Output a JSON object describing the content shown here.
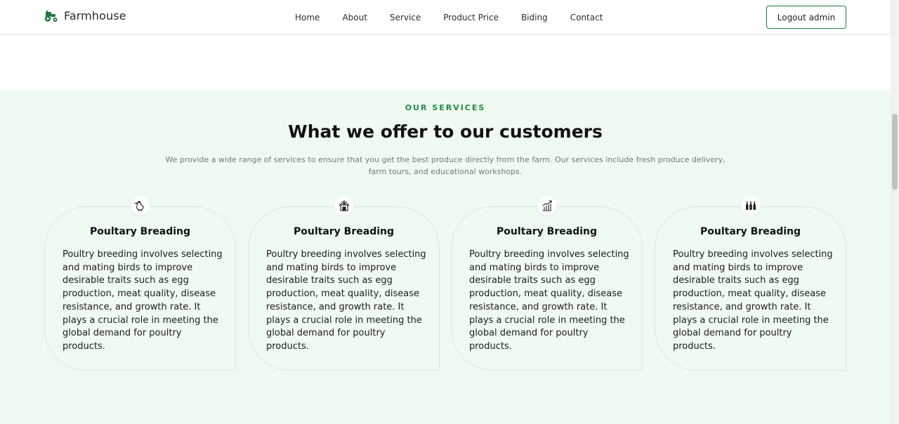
{
  "navbar": {
    "brand": "Farmhouse",
    "links": [
      "Home",
      "About",
      "Service",
      "Product Price",
      "Biding",
      "Contact"
    ],
    "logout_label": "Logout admin"
  },
  "services": {
    "eyebrow": "OUR SERVICES",
    "title": "What we offer to our customers",
    "description": "We provide a wide range of services to ensure that you get the best produce directly from the farm. Our services include fresh produce delivery, farm tours, and educational workshops.",
    "cards": [
      {
        "icon": "chicken-icon",
        "title": "Poultary Breading",
        "text": "Poultry breeding involves selecting and mating birds to improve desirable traits such as egg production, meat quality, disease resistance, and growth rate. It plays a crucial role in meeting the global demand for poultry products."
      },
      {
        "icon": "barn-icon",
        "title": "Poultary Breading",
        "text": "Poultry breeding involves selecting and mating birds to improve desirable traits such as egg production, meat quality, disease resistance, and growth rate. It plays a crucial role in meeting the global demand for poultry products."
      },
      {
        "icon": "growth-chart-icon",
        "title": "Poultary Breading",
        "text": "Poultry breeding involves selecting and mating birds to improve desirable traits such as egg production, meat quality, disease resistance, and growth rate. It plays a crucial role in meeting the global demand for poultry products."
      },
      {
        "icon": "bottles-icon",
        "title": "Poultary Breading",
        "text": "Poultry breeding involves selecting and mating birds to improve desirable traits such as egg production, meat quality, disease resistance, and growth rate. It plays a crucial role in meeting the global demand for poultry products."
      }
    ]
  },
  "colors": {
    "accent": "#1e8a45",
    "section_bg": "#effbf1",
    "logo": "#1e7a3d"
  }
}
